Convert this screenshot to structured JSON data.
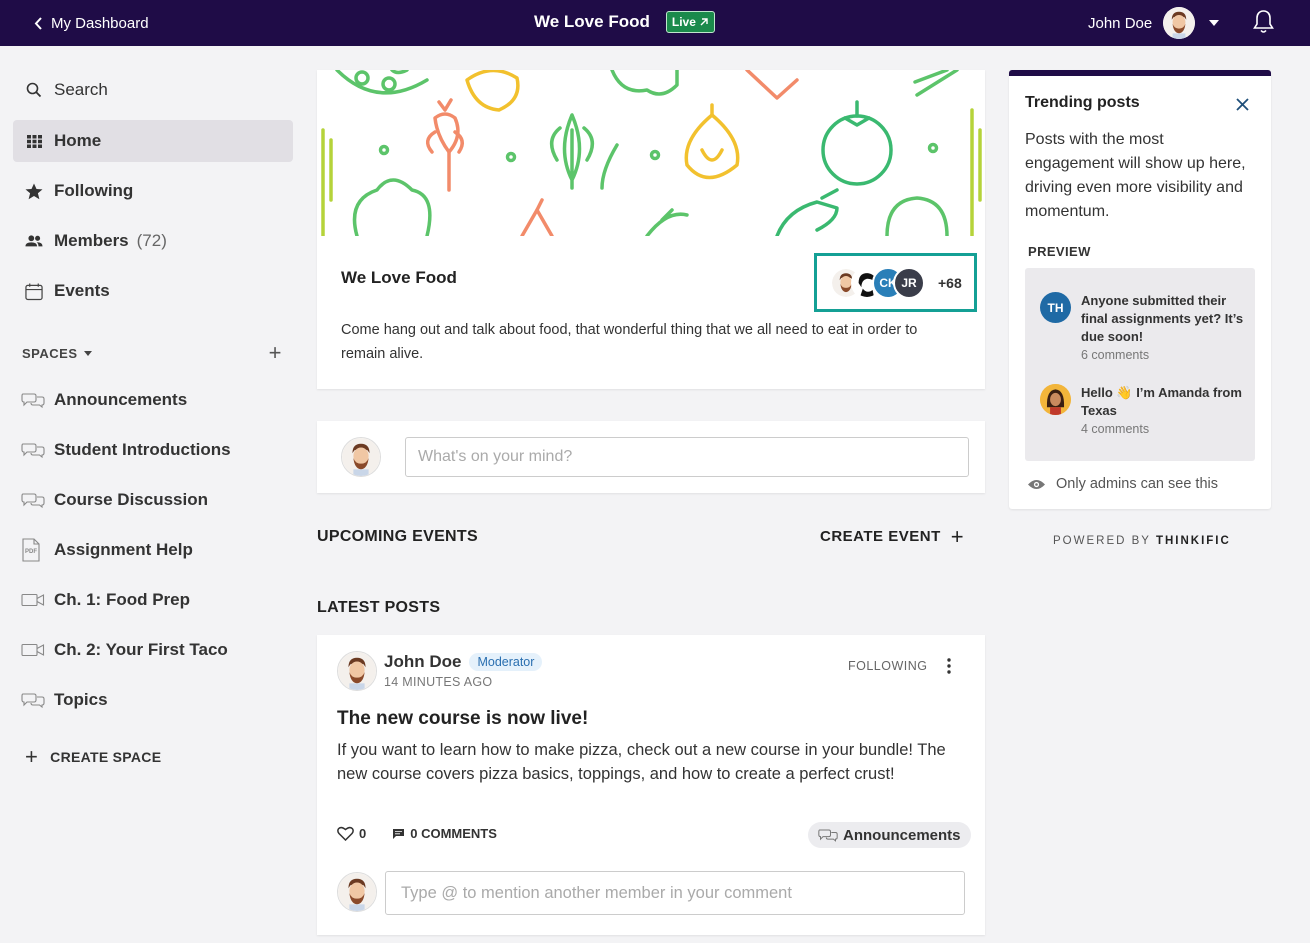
{
  "topbar": {
    "back_label": "My Dashboard",
    "community_title": "We Love Food",
    "live_label": "Live",
    "user_name": "John Doe"
  },
  "sidebar": {
    "search_label": "Search",
    "home_label": "Home",
    "following_label": "Following",
    "members_label": "Members",
    "members_count": "(72)",
    "events_label": "Events",
    "spaces_heading": "SPACES",
    "spaces": [
      {
        "label": "Announcements",
        "icon": "chat-bubbles-icon"
      },
      {
        "label": "Student Introductions",
        "icon": "chat-bubbles-icon"
      },
      {
        "label": "Course Discussion",
        "icon": "chat-bubbles-icon"
      },
      {
        "label": "Assignment Help",
        "icon": "pdf-icon"
      },
      {
        "label": "Ch. 1: Food Prep",
        "icon": "video-icon"
      },
      {
        "label": "Ch. 2: Your First Taco",
        "icon": "video-icon"
      },
      {
        "label": "Topics",
        "icon": "chat-bubbles-icon"
      }
    ],
    "create_space_label": "CREATE SPACE"
  },
  "hero": {
    "title": "We Love Food",
    "description": "Come hang out and talk about food, that wonderful thing that we all need to eat in order to remain alive.",
    "member_initials": [
      "CK",
      "JR"
    ],
    "more_members": "+68"
  },
  "composer": {
    "placeholder": "What's on your mind?"
  },
  "events": {
    "heading": "UPCOMING EVENTS",
    "create_label": "CREATE EVENT"
  },
  "posts": {
    "heading": "LATEST POSTS",
    "items": [
      {
        "author": "John Doe",
        "role_badge": "Moderator",
        "time": "14 MINUTES AGO",
        "follow_state": "FOLLOWING",
        "title": "The new course is now live!",
        "body": "If you want to learn how to make pizza, check out a new course in your bundle! The new course covers pizza basics, toppings, and how to create a perfect crust!",
        "likes": "0",
        "comments_label": "0 COMMENTS",
        "space": "Announcements",
        "comment_placeholder": "Type @ to mention another member in your comment"
      }
    ]
  },
  "trending": {
    "title": "Trending posts",
    "description": "Posts with the most engagement will show up here, driving even more visibility and momentum.",
    "preview_label": "PREVIEW",
    "items": [
      {
        "initials": "TH",
        "title": "Anyone submitted their final assignments yet? It’s due soon!",
        "comments": "6 comments"
      },
      {
        "initials": "",
        "title": "Hello 👋 I’m Amanda from Texas",
        "comments": "4 comments"
      }
    ],
    "admin_note": "Only admins can see this"
  },
  "footer": {
    "powered_prefix": "POWERED BY",
    "powered_brand": "THINKIFIC"
  },
  "colors": {
    "topbar": "#1f0c47",
    "live": "#1a8a4b",
    "highlight": "#14a095",
    "th_avatar": "#1f6aa5",
    "ck_avatar": "#2a7fb8",
    "jr_avatar": "#3a3d4a"
  }
}
